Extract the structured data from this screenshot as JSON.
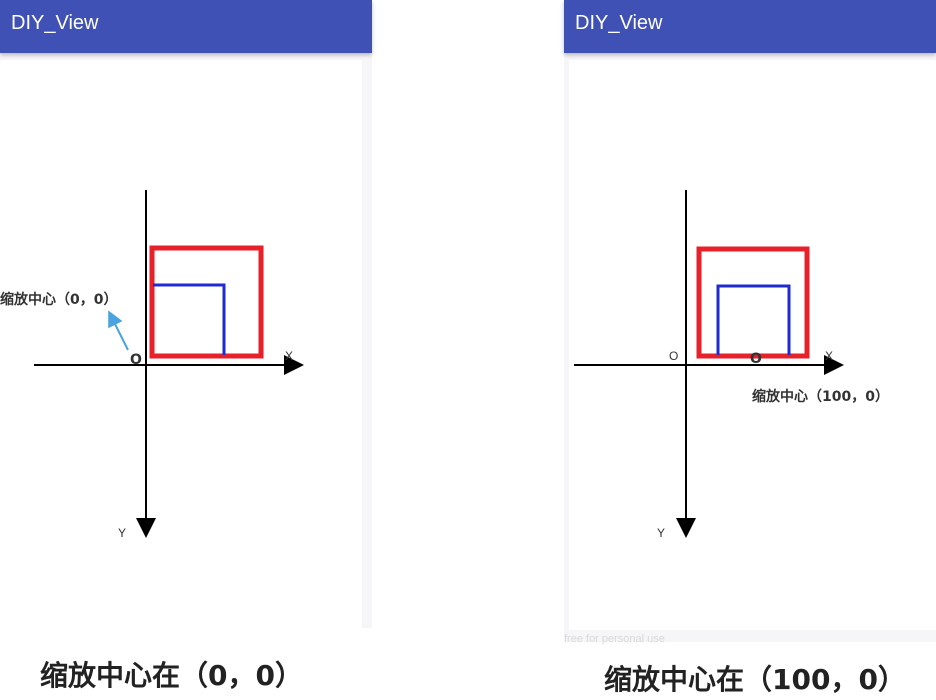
{
  "panels": [
    {
      "app_title": "DIY_View",
      "x_label": "X",
      "y_label": "Y",
      "origin_label": "O",
      "scale_center_label": "O",
      "annotation": "缩放中心（0，0）",
      "caption": "缩放中心在（0，0）"
    },
    {
      "app_title": "DIY_View",
      "x_label": "X",
      "y_label": "Y",
      "origin_label": "O",
      "scale_center_label": "O",
      "annotation": "缩放中心（100，0）",
      "caption": "缩放中心在（100，0）"
    }
  ],
  "watermark": "free for personal use",
  "colors": {
    "appbar": "#3f51b5",
    "outer_rect": "#e8202a",
    "inner_rect": "#1f2bd0",
    "arrow": "#4aa3df",
    "axes": "#000000"
  }
}
